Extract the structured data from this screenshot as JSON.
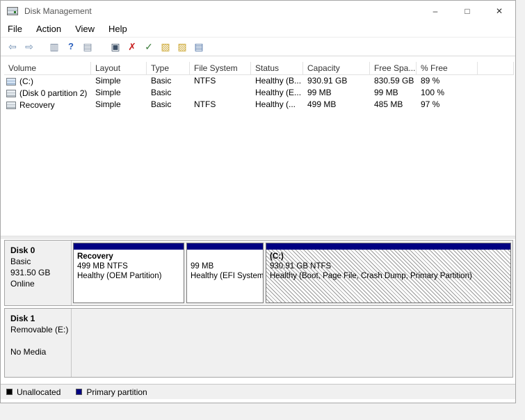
{
  "window": {
    "title": "Disk Management",
    "controls": {
      "minimize": "–",
      "maximize": "□",
      "close": "✕"
    }
  },
  "menubar": {
    "items": [
      "File",
      "Action",
      "View",
      "Help"
    ]
  },
  "toolbar": {
    "buttons": [
      {
        "name": "back",
        "glyph": "⇦",
        "color": "#6d8cb0"
      },
      {
        "name": "forward",
        "glyph": "⇨",
        "color": "#6d8cb0"
      },
      {
        "name": "console-tree",
        "glyph": "▥",
        "color": "#7a8aa0"
      },
      {
        "name": "help",
        "glyph": "?",
        "color": "#2a5fbd"
      },
      {
        "name": "export-list",
        "glyph": "▤",
        "color": "#7a8aa0"
      },
      {
        "name": "properties",
        "glyph": "▣",
        "color": "#3c4f66"
      },
      {
        "name": "delete",
        "glyph": "✗",
        "color": "#c81e1e"
      },
      {
        "name": "check",
        "glyph": "✓",
        "color": "#3b7d3b"
      },
      {
        "name": "refresh",
        "glyph": "▧",
        "color": "#c9a227"
      },
      {
        "name": "rescan",
        "glyph": "▨",
        "color": "#c9a227"
      },
      {
        "name": "details",
        "glyph": "▤",
        "color": "#4a6fa5"
      }
    ]
  },
  "volume_table": {
    "headers": [
      "Volume",
      "Layout",
      "Type",
      "File System",
      "Status",
      "Capacity",
      "Free Spa...",
      "% Free"
    ],
    "rows": [
      {
        "volume": "(C:)",
        "layout": "Simple",
        "type": "Basic",
        "file_system": "NTFS",
        "status": "Healthy (B...",
        "capacity": "930.91 GB",
        "free_space": "830.59 GB",
        "pct_free": "89 %"
      },
      {
        "volume": "(Disk 0 partition 2)",
        "layout": "Simple",
        "type": "Basic",
        "file_system": "",
        "status": "Healthy (E...",
        "capacity": "99 MB",
        "free_space": "99 MB",
        "pct_free": "100 %"
      },
      {
        "volume": "Recovery",
        "layout": "Simple",
        "type": "Basic",
        "file_system": "NTFS",
        "status": "Healthy (...",
        "capacity": "499 MB",
        "free_space": "485 MB",
        "pct_free": "97 %"
      }
    ]
  },
  "disks": [
    {
      "name": "Disk 0",
      "type": "Basic",
      "size": "931.50 GB",
      "status": "Online",
      "partitions": [
        {
          "name": "Recovery",
          "size": "499 MB NTFS",
          "status": "Healthy (OEM Partition)"
        },
        {
          "name": "",
          "size": "99 MB",
          "status": "Healthy (EFI System"
        },
        {
          "name": "(C:)",
          "size": "930.91 GB NTFS",
          "status": "Healthy (Boot, Page File, Crash Dump, Primary Partition)"
        }
      ]
    },
    {
      "name": "Disk 1",
      "type": "Removable (E:)",
      "size": "",
      "status": "No Media",
      "partitions": []
    }
  ],
  "legend": {
    "items": [
      {
        "label": "Unallocated",
        "color": "#000000"
      },
      {
        "label": "Primary partition",
        "color": "#000082"
      }
    ]
  },
  "colors": {
    "partition_bar": "#000082"
  }
}
